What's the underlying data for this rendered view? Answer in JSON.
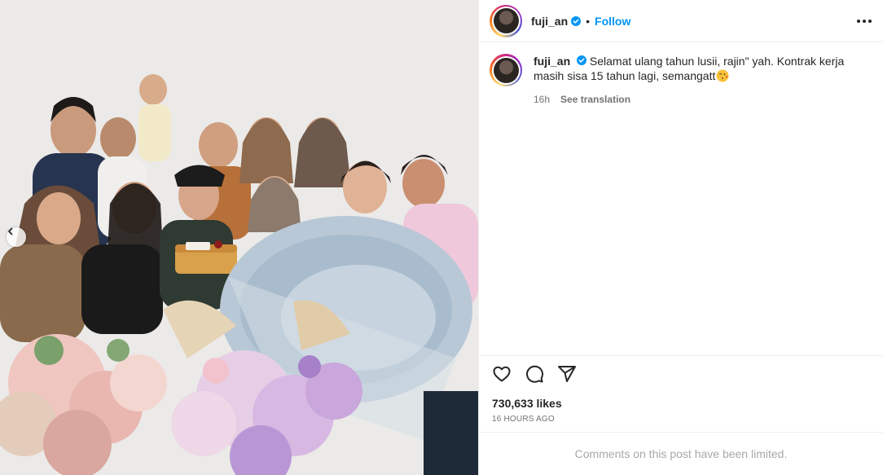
{
  "post": {
    "photo_alt": "group photo",
    "carousel_prev_icon": "chevron-left-icon"
  },
  "header": {
    "username": "fuji_an",
    "verified_icon": "verified-badge-icon",
    "separator": "•",
    "follow_label": "Follow",
    "more_icon": "more-options-icon"
  },
  "caption": {
    "username": "fuji_an",
    "text": "Selamat ulang tahun lusii, rajin\" yah. Kontrak kerja masih sisa 15 tahun lagi, semangatt",
    "emoji_icon": "kissing-face-emoji-icon",
    "time": "16h",
    "see_translation": "See translation"
  },
  "actions": {
    "like_icon": "heart-icon",
    "comment_icon": "comment-icon",
    "share_icon": "share-icon",
    "likes": "730,633 likes",
    "timestamp": "16 HOURS AGO"
  },
  "footer": {
    "comments_limited": "Comments on this post have been limited."
  },
  "colors": {
    "accent": "#0095f6",
    "text": "#262626",
    "secondary": "#737373",
    "muted": "#a8a8a8",
    "divider": "#efefef"
  }
}
